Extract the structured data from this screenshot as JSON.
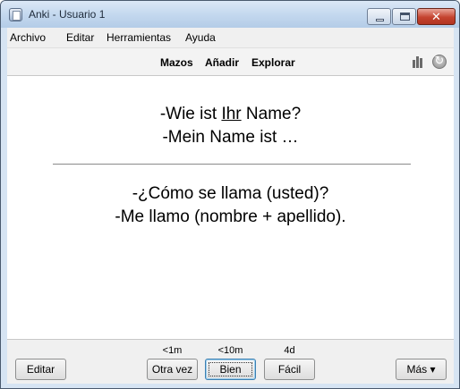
{
  "window": {
    "title": "Anki - Usuario 1",
    "controls": {
      "minimize": "minimize",
      "maximize": "maximize",
      "close": "✕"
    }
  },
  "menubar": {
    "items": [
      "Archivo",
      "Editar",
      "Herramientas",
      "Ayuda"
    ]
  },
  "toolbar": {
    "links": [
      "Mazos",
      "Añadir",
      "Explorar"
    ],
    "icons": [
      "stats-icon",
      "sync-icon"
    ]
  },
  "card": {
    "front": {
      "line1_before": "-Wie ist ",
      "line1_underlined": "Ihr",
      "line1_after": " Name?",
      "line2": "-Mein Name ist …"
    },
    "back": {
      "line1": "-¿Cómo se llama (usted)?",
      "line2": "-Me llamo (nombre + apellido)."
    }
  },
  "bottombar": {
    "edit_label": "Editar",
    "answers": [
      {
        "interval": "<1m",
        "label": "Otra vez"
      },
      {
        "interval": "<10m",
        "label": "Bien"
      },
      {
        "interval": "4d",
        "label": "Fácil"
      }
    ],
    "more_label": "Más ▾"
  }
}
